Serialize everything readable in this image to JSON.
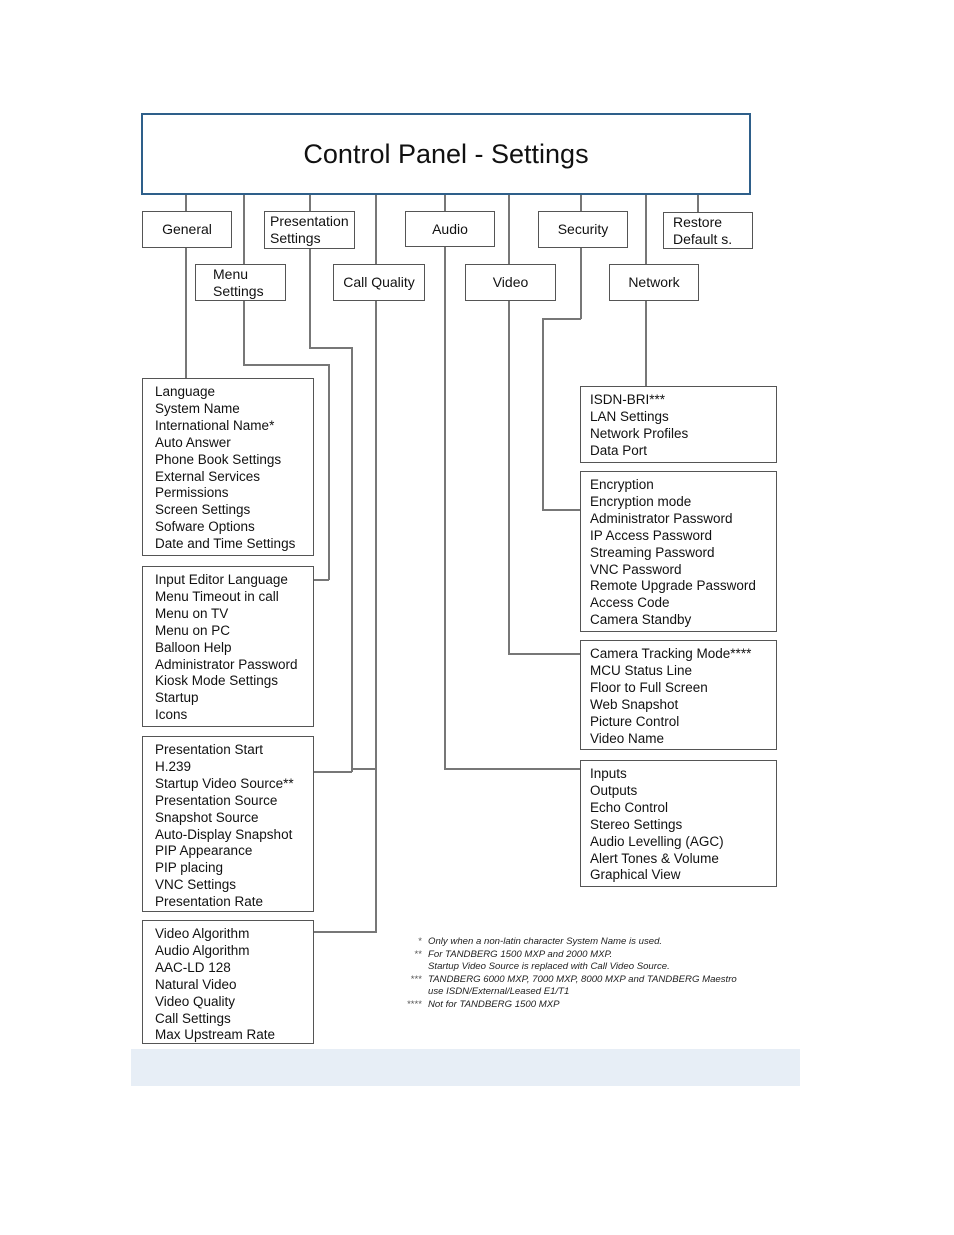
{
  "title": "Control Panel - Settings",
  "categories": {
    "general": "General",
    "menu_settings": "Menu Settings",
    "presentation_settings": "Presentation Settings",
    "call_quality": "Call Quality",
    "audio": "Audio",
    "video": "Video",
    "security": "Security",
    "network": "Network",
    "restore_defaults": "Restore Default s."
  },
  "lists": {
    "general": [
      "Language",
      "System Name",
      "International Name*",
      "Auto Answer",
      "Phone Book Settings",
      "External Services",
      "Permissions",
      "Screen Settings",
      "Sofware Options",
      "Date and Time Settings"
    ],
    "menu_settings": [
      "Input Editor Language",
      "Menu Timeout in call",
      "Menu on TV",
      "Menu on PC",
      "Balloon Help",
      "Administrator Password",
      "Kiosk Mode Settings",
      "Startup",
      "Icons"
    ],
    "presentation_settings": [
      "Presentation Start",
      "H.239",
      "Startup Video Source**",
      "Presentation Source",
      "Snapshot Source",
      "Auto-Display Snapshot",
      "PIP Appearance",
      "PIP placing",
      "VNC Settings",
      "Presentation Rate"
    ],
    "call_quality": [
      "Video Algorithm",
      "Audio Algorithm",
      "AAC-LD 128",
      "Natural Video",
      "Video Quality",
      "Call Settings",
      "Max Upstream Rate"
    ],
    "network": [
      "ISDN-BRI***",
      "LAN Settings",
      "Network Profiles",
      "Data Port"
    ],
    "security": [
      "Encryption",
      "Encryption mode",
      "Administrator Password",
      "IP Access Password",
      "Streaming Password",
      "VNC Password",
      "Remote Upgrade Password",
      "Access Code",
      "Camera Standby"
    ],
    "video": [
      "Camera Tracking Mode****",
      "MCU Status Line",
      "Floor to Full Screen",
      "Web Snapshot",
      "Picture Control",
      "Video Name"
    ],
    "audio": [
      "Inputs",
      "Outputs",
      "Echo Control",
      "Stereo Settings",
      "Audio Levelling (AGC)",
      "Alert Tones & Volume",
      "Graphical View"
    ]
  },
  "footnotes": [
    {
      "mark": "*",
      "text": "Only when a non-latin character System Name is used."
    },
    {
      "mark": "**",
      "text": "For TANDBERG 1500 MXP and 2000 MXP."
    },
    {
      "mark": "",
      "text": "Startup Video Source is replaced with Call Video Source."
    },
    {
      "mark": "***",
      "text": "TANDBERG 6000 MXP, 7000 MXP, 8000 MXP and TANDBERG Maestro"
    },
    {
      "mark": "",
      "text": "use ISDN/External/Leased E1/T1"
    },
    {
      "mark": "****",
      "text": "Not for TANDBERG 1500 MXP"
    }
  ],
  "colors": {
    "title_border": "#2e5f8a",
    "box_border": "#555555",
    "connector": "#777777",
    "bottom_band": "#e7eef6"
  }
}
